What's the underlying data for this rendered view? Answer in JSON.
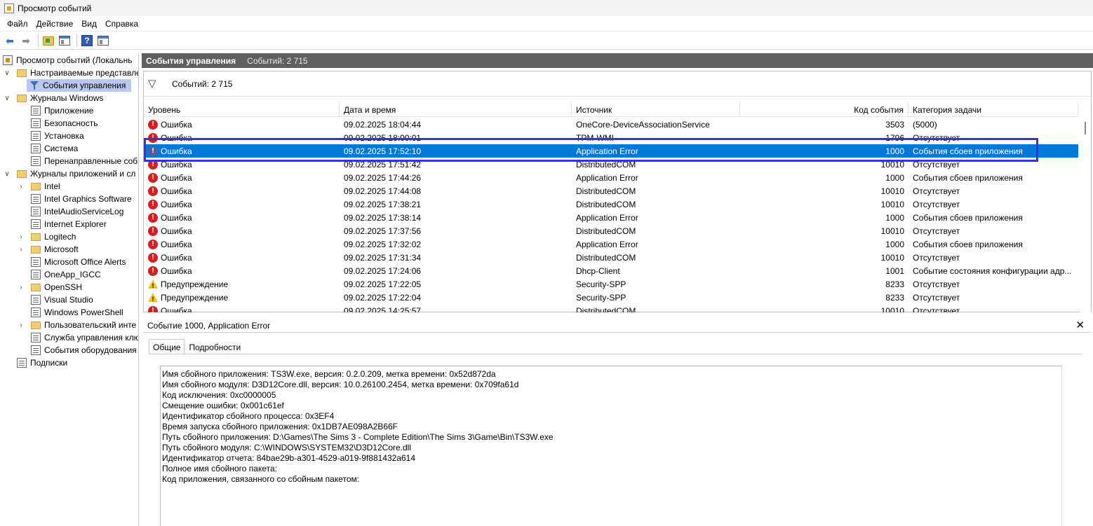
{
  "window": {
    "title": "Просмотр событий"
  },
  "menu": [
    "Файл",
    "Действие",
    "Вид",
    "Справка"
  ],
  "tree": {
    "items": [
      {
        "label": "Просмотр событий (Локальнь",
        "icon": "event-viewer-icon",
        "expander": ""
      },
      {
        "label": "Настраиваемые представле",
        "icon": "folder-icon",
        "expander": "v"
      },
      {
        "label": "События управления",
        "icon": "filter-icon",
        "expander": ""
      },
      {
        "label": "Журналы Windows",
        "icon": "folder-icon",
        "expander": "v"
      },
      {
        "label": "Приложение",
        "icon": "log-icon",
        "expander": ""
      },
      {
        "label": "Безопасность",
        "icon": "log-icon",
        "expander": ""
      },
      {
        "label": "Установка",
        "icon": "log-icon",
        "expander": ""
      },
      {
        "label": "Система",
        "icon": "log-icon",
        "expander": ""
      },
      {
        "label": "Перенаправленные соб",
        "icon": "log-icon",
        "expander": ""
      },
      {
        "label": "Журналы приложений и сл",
        "icon": "folder-icon",
        "expander": "v"
      },
      {
        "label": "Intel",
        "icon": "folder-icon",
        "expander": ">"
      },
      {
        "label": "Intel Graphics Software",
        "icon": "log-icon",
        "expander": ""
      },
      {
        "label": "IntelAudioServiceLog",
        "icon": "log-icon",
        "expander": ""
      },
      {
        "label": "Internet Explorer",
        "icon": "log-icon",
        "expander": ""
      },
      {
        "label": "Logitech",
        "icon": "folder-icon",
        "expander": ">"
      },
      {
        "label": "Microsoft",
        "icon": "folder-icon",
        "expander": ">"
      },
      {
        "label": "Microsoft Office Alerts",
        "icon": "log-icon",
        "expander": ""
      },
      {
        "label": "OneApp_IGCC",
        "icon": "log-icon",
        "expander": ""
      },
      {
        "label": "OpenSSH",
        "icon": "folder-icon",
        "expander": ">"
      },
      {
        "label": "Visual Studio",
        "icon": "log-icon",
        "expander": ""
      },
      {
        "label": "Windows PowerShell",
        "icon": "log-icon",
        "expander": ""
      },
      {
        "label": "Пользовательский инте",
        "icon": "folder-icon",
        "expander": ">"
      },
      {
        "label": "Служба управления клю",
        "icon": "log-icon",
        "expander": ""
      },
      {
        "label": "События оборудования",
        "icon": "log-icon",
        "expander": ""
      },
      {
        "label": "Подписки",
        "icon": "log-icon",
        "expander": ""
      }
    ]
  },
  "pane": {
    "title": "События управления",
    "count": "Событий: 2 715"
  },
  "filter": {
    "count": "Событий: 2 715"
  },
  "columns": [
    "Уровень",
    "Дата и время",
    "Источник",
    "Код события",
    "Категория задачи"
  ],
  "events": [
    {
      "level": "Ошибка",
      "type": "error",
      "date": "09.02.2025 18:04:44",
      "source": "OneCore-DeviceAssociationService",
      "code": "3503",
      "category": "(5000)"
    },
    {
      "level": "Ошибка",
      "type": "error",
      "date": "09.02.2025 18:00:01",
      "source": "TPM-WMI",
      "code": "1796",
      "category": "Отсутствует"
    },
    {
      "level": "Ошибка",
      "type": "error",
      "date": "09.02.2025 17:52:10",
      "source": "Application Error",
      "code": "1000",
      "category": "События сбоев приложения"
    },
    {
      "level": "Ошибка",
      "type": "error",
      "date": "09.02.2025 17:51:42",
      "source": "DistributedCOM",
      "code": "10010",
      "category": "Отсутствует"
    },
    {
      "level": "Ошибка",
      "type": "error",
      "date": "09.02.2025 17:44:26",
      "source": "Application Error",
      "code": "1000",
      "category": "События сбоев приложения"
    },
    {
      "level": "Ошибка",
      "type": "error",
      "date": "09.02.2025 17:44:08",
      "source": "DistributedCOM",
      "code": "10010",
      "category": "Отсутствует"
    },
    {
      "level": "Ошибка",
      "type": "error",
      "date": "09.02.2025 17:38:21",
      "source": "DistributedCOM",
      "code": "10010",
      "category": "Отсутствует"
    },
    {
      "level": "Ошибка",
      "type": "error",
      "date": "09.02.2025 17:38:14",
      "source": "Application Error",
      "code": "1000",
      "category": "События сбоев приложения"
    },
    {
      "level": "Ошибка",
      "type": "error",
      "date": "09.02.2025 17:37:56",
      "source": "DistributedCOM",
      "code": "10010",
      "category": "Отсутствует"
    },
    {
      "level": "Ошибка",
      "type": "error",
      "date": "09.02.2025 17:32:02",
      "source": "Application Error",
      "code": "1000",
      "category": "События сбоев приложения"
    },
    {
      "level": "Ошибка",
      "type": "error",
      "date": "09.02.2025 17:31:34",
      "source": "DistributedCOM",
      "code": "10010",
      "category": "Отсутствует"
    },
    {
      "level": "Ошибка",
      "type": "error",
      "date": "09.02.2025 17:24:06",
      "source": "Dhcp-Client",
      "code": "1001",
      "category": "Событие состояния конфигурации адр..."
    },
    {
      "level": "Предупреждение",
      "type": "warning",
      "date": "09.02.2025 17:22:05",
      "source": "Security-SPP",
      "code": "8233",
      "category": "Отсутствует"
    },
    {
      "level": "Предупреждение",
      "type": "warning",
      "date": "09.02.2025 17:22:04",
      "source": "Security-SPP",
      "code": "8233",
      "category": "Отсутствует"
    },
    {
      "level": "Ошибка",
      "type": "error",
      "date": "09.02.2025 14:25:57",
      "source": "DistributedCOM",
      "code": "10010",
      "category": "Отсутствует"
    }
  ],
  "selected_index": 2,
  "detail": {
    "title": "Событие 1000, Application Error",
    "tabs": [
      "Общие",
      "Подробности"
    ],
    "lines": [
      "Имя сбойного приложения: TS3W.exe, версия: 0.2.0.209, метка времени: 0x52d872da",
      "Имя сбойного модуля: D3D12Core.dll, версия: 10.0.26100.2454, метка времени: 0x709fa61d",
      "Код исключения: 0xc0000005",
      "Смещение ошибки: 0x001c61ef",
      "Идентификатор сбойного процесса: 0x3EF4",
      "Время запуска сбойного приложения: 0x1DB7AE098A2B66F",
      "Путь сбойного приложения: D:\\Games\\The Sims 3 - Complete Edition\\The Sims 3\\Game\\Bin\\TS3W.exe",
      "Путь сбойного модуля: C:\\WINDOWS\\SYSTEM32\\D3D12Core.dll",
      "Идентификатор отчета: 84bae29b-a301-4529-a019-9f881432a614",
      "Полное имя сбойного пакета:",
      "Код приложения, связанного со сбойным пакетом:"
    ]
  },
  "colors": {
    "selection": "#0078d7",
    "highlight_box": "#3a32d4",
    "pane_header": "#5f5f5f"
  }
}
